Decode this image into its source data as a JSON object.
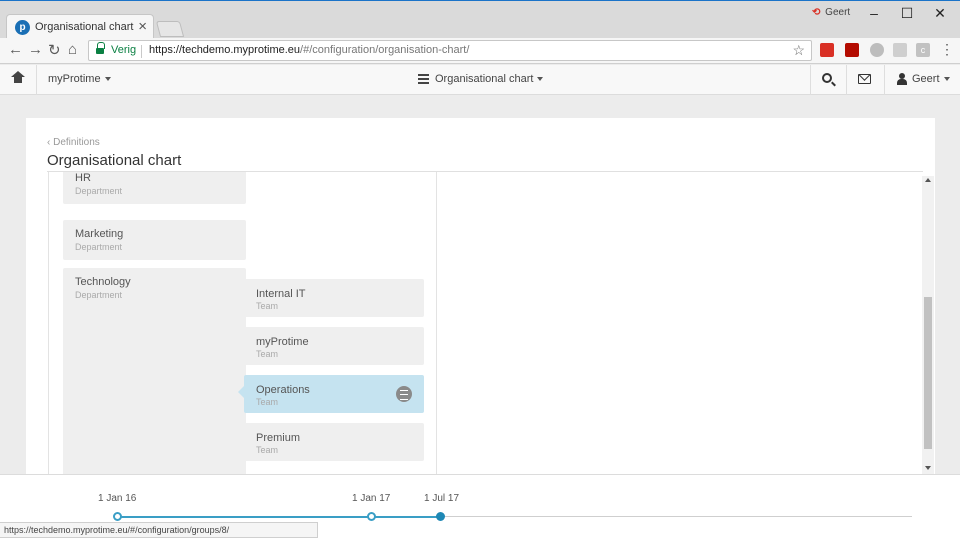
{
  "browser": {
    "tab_title": "Organisational chart - my",
    "tab_favicon": "p",
    "tab_close": "×",
    "user_badge": "Geert",
    "window_controls": {
      "minimize": "–",
      "maximize": "☐",
      "close": "✕"
    },
    "secure_label": "Verig",
    "url_host": "https://techdemo.myprotime.eu",
    "url_path": "/#/configuration/organisation-chart/",
    "status_url": "https://techdemo.myprotime.eu/#/configuration/groups/8/",
    "extension_c_label": "c"
  },
  "nav_icons": {
    "back": "←",
    "forward": "→",
    "reload": "↻",
    "home": "⌂",
    "star": "☆",
    "menu": "⋮"
  },
  "appbar": {
    "app_menu": "myProtime",
    "module_title": "Organisational chart",
    "user_name": "Geert"
  },
  "page": {
    "breadcrumb": "‹ Definitions",
    "title": "Organisational chart"
  },
  "org": {
    "departments": [
      {
        "name": "HR",
        "type": "Department"
      },
      {
        "name": "Marketing",
        "type": "Department"
      },
      {
        "name": "Technology",
        "type": "Department"
      }
    ],
    "teams": [
      {
        "name": "Internal IT",
        "type": "Team",
        "selected": false
      },
      {
        "name": "myProtime",
        "type": "Team",
        "selected": false
      },
      {
        "name": "Operations",
        "type": "Team",
        "selected": true
      },
      {
        "name": "Premium",
        "type": "Team",
        "selected": false
      }
    ]
  },
  "timeline": {
    "dates": [
      "1 Jan 16",
      "1 Jan 17",
      "1 Jul 17"
    ],
    "active_date": "1 Jul 17"
  },
  "colors": {
    "accent": "#3a9ec5",
    "selected_node": "#c5e3f0",
    "node_bg": "#efefef",
    "secure_green": "#0b8043"
  }
}
